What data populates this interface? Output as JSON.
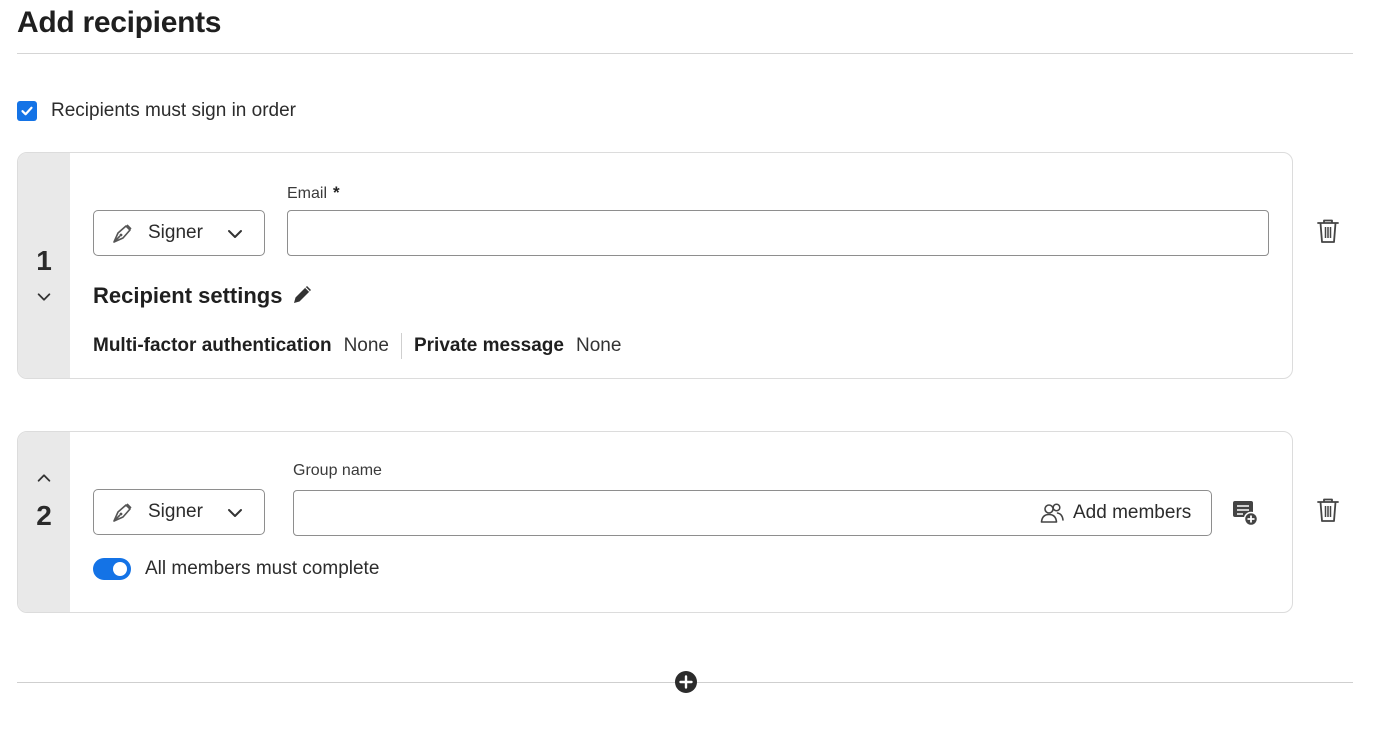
{
  "page": {
    "title": "Add recipients"
  },
  "order": {
    "label": "Recipients must sign in order",
    "checked": true
  },
  "recipients": [
    {
      "number": "1",
      "role": "Signer",
      "email_label": "Email",
      "required_marker": "*",
      "email_value": "",
      "settings_title": "Recipient settings",
      "mfa_label": "Multi-factor authentication",
      "mfa_value": "None",
      "private_message_label": "Private message",
      "private_message_value": "None"
    },
    {
      "number": "2",
      "role": "Signer",
      "group_label": "Group name",
      "group_value": "",
      "add_members_label": "Add members",
      "toggle_label": "All members must complete",
      "toggle_on": true
    }
  ],
  "colors": {
    "accent": "#1473e6",
    "rail": "#e9e9e9",
    "border": "#dcdcdc"
  },
  "icons": [
    "checkmark-icon",
    "pen-nib-icon",
    "chevron-down-icon",
    "chevron-up-icon",
    "pencil-icon",
    "people-icon",
    "list-add-icon",
    "trash-icon",
    "plus-circle-icon"
  ]
}
